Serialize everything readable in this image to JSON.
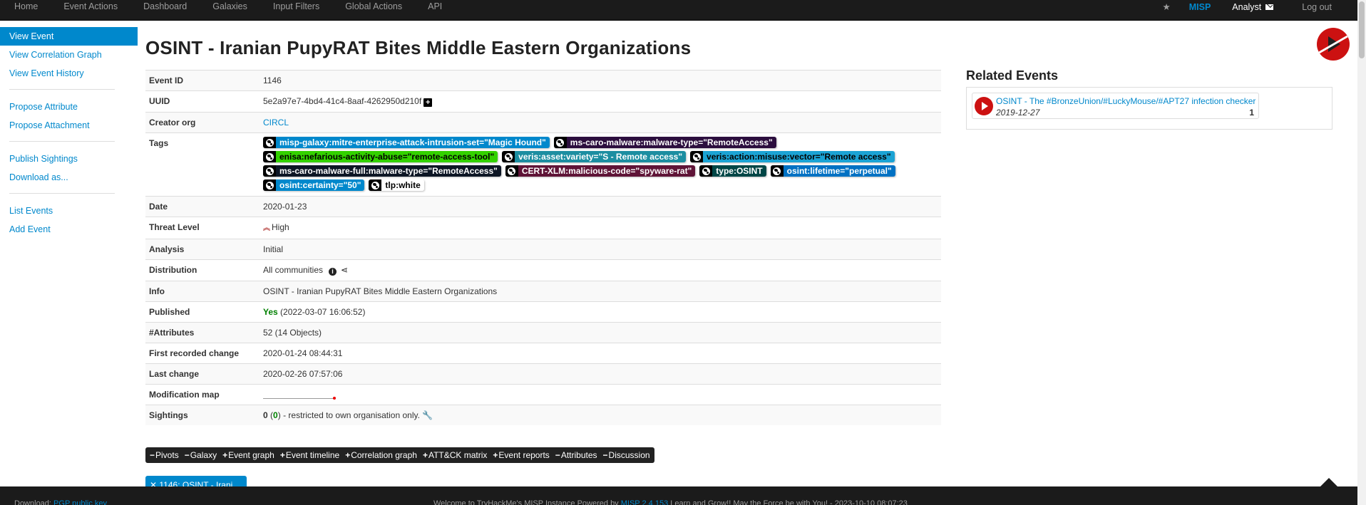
{
  "topnav": {
    "left": [
      "Home",
      "Event Actions",
      "Dashboard",
      "Galaxies",
      "Input Filters",
      "Global Actions",
      "API"
    ],
    "star_icon": "star-icon",
    "misp": "MISP",
    "user": "Analyst",
    "mail_icon": "envelope-icon",
    "logout": "Log out"
  },
  "sidebar": {
    "group1": [
      "View Event",
      "View Correlation Graph",
      "View Event History"
    ],
    "group2": [
      "Propose Attribute",
      "Propose Attachment"
    ],
    "group3": [
      "Publish Sightings",
      "Download as..."
    ],
    "group4": [
      "List Events",
      "Add Event"
    ]
  },
  "event": {
    "title": "OSINT - Iranian PupyRAT Bites Middle Eastern Organizations",
    "rows": {
      "event_id": {
        "label": "Event ID",
        "value": "1146"
      },
      "uuid": {
        "label": "UUID",
        "value": "5e2a97e7-4bd4-41c4-8aaf-4262950d210f"
      },
      "creator_org": {
        "label": "Creator org",
        "value": "CIRCL"
      },
      "tags_label": "Tags",
      "date": {
        "label": "Date",
        "value": "2020-01-23"
      },
      "threat_level": {
        "label": "Threat Level",
        "value": "High"
      },
      "analysis": {
        "label": "Analysis",
        "value": "Initial"
      },
      "distribution": {
        "label": "Distribution",
        "value": "All communities"
      },
      "info": {
        "label": "Info",
        "value": "OSINT - Iranian PupyRAT Bites Middle Eastern Organizations"
      },
      "published": {
        "label": "Published",
        "value": "Yes",
        "detail": "(2022-03-07 16:06:52)"
      },
      "attributes": {
        "label": "#Attributes",
        "value": "52 (14 Objects)"
      },
      "first_change": {
        "label": "First recorded change",
        "value": "2020-01-24 08:44:31"
      },
      "last_change": {
        "label": "Last change",
        "value": "2020-02-26 07:57:06"
      },
      "modification_map": {
        "label": "Modification map"
      },
      "sightings": {
        "label": "Sightings",
        "count": "0",
        "open": "(",
        "own": "0",
        "close": ")",
        "rest": "- restricted to own organisation only."
      }
    },
    "tags": [
      {
        "text": "misp-galaxy:mitre-enterprise-attack-intrusion-set=\"Magic Hound\"",
        "bg": "#0088cc",
        "fg": "#ffffff"
      },
      {
        "text": "ms-caro-malware:malware-type=\"RemoteAccess\"",
        "bg": "#2c0e3e",
        "fg": "#ffffff"
      },
      {
        "text": "enisa:nefarious-activity-abuse=\"remote-access-tool\"",
        "bg": "#33d100",
        "fg": "#000000"
      },
      {
        "text": "veris:asset:variety=\"S - Remote access\"",
        "bg": "#1c8ea1",
        "fg": "#ffffff"
      },
      {
        "text": "veris:action:misuse:vector=\"Remote access\"",
        "bg": "#1ba3d4",
        "fg": "#000000"
      },
      {
        "text": "ms-caro-malware-full:malware-type=\"RemoteAccess\"",
        "bg": "#0d1625",
        "fg": "#ffffff"
      },
      {
        "text": "CERT-XLM:malicious-code=\"spyware-rat\"",
        "bg": "#5f1437",
        "fg": "#ffffff"
      },
      {
        "text": "type:OSINT",
        "bg": "#004646",
        "fg": "#ffffff"
      },
      {
        "text": "osint:lifetime=\"perpetual\"",
        "bg": "#0071c3",
        "fg": "#ffffff"
      },
      {
        "text": "osint:certainty=\"50\"",
        "bg": "#0088cc",
        "fg": "#ffffff"
      },
      {
        "text": "tlp:white",
        "bg": "#ffffff",
        "fg": "#000000"
      }
    ]
  },
  "related": {
    "title": "Related Events",
    "items": [
      {
        "title": "OSINT - The #BronzeUnion/#LuckyMouse/#APT27 infection checker",
        "date": "2019-12-27",
        "count": "1"
      }
    ]
  },
  "tabs": [
    {
      "icon": "−",
      "label": "Pivots"
    },
    {
      "icon": "−",
      "label": "Galaxy"
    },
    {
      "icon": "+",
      "label": "Event graph"
    },
    {
      "icon": "+",
      "label": "Event timeline"
    },
    {
      "icon": "+",
      "label": "Correlation graph"
    },
    {
      "icon": "+",
      "label": "ATT&CK matrix"
    },
    {
      "icon": "+",
      "label": "Event reports"
    },
    {
      "icon": "−",
      "label": "Attributes"
    },
    {
      "icon": "−",
      "label": "Discussion"
    }
  ],
  "pivot_tab": "✕ 1146: OSINT - Irani...",
  "footer": {
    "left_prefix": "Download:",
    "left_link": "PGP public key",
    "center_prefix": "Welcome to TryHackMe's MISP Instance Powered by",
    "center_link": "MISP 2.4.153",
    "center_suffix": "Learn and Grow!! May the Force be with You! - 2023-10-10 08:07:23"
  }
}
